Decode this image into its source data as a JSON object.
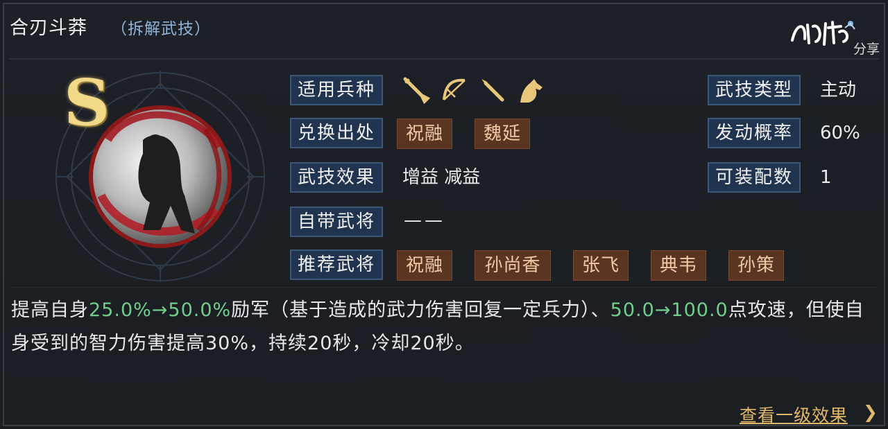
{
  "header": {
    "title": "合刃斗莽",
    "subtitle": "（拆解武技）",
    "brand_logo": "鸿图",
    "brand_share": "分享"
  },
  "skill": {
    "rank": "S",
    "attributes": {
      "troop_label": "适用兵种",
      "troop_icons": [
        "sword-icon",
        "bow-icon",
        "spear-icon",
        "horse-icon"
      ],
      "source_label": "兑换出处",
      "sources": [
        "祝融",
        "魏延"
      ],
      "effect_label": "武技效果",
      "effect_value": "增益 减益",
      "own_general_label": "自带武将",
      "own_general_value": "——",
      "recommend_label": "推荐武将",
      "recommended": [
        "祝融",
        "孙尚香",
        "张飞",
        "典韦",
        "孙策"
      ],
      "type_label": "武技类型",
      "type_value": "主动",
      "trigger_label": "发动概率",
      "trigger_value": "60%",
      "equip_label": "可装配数",
      "equip_value": "1"
    }
  },
  "description": {
    "p1": "提高自身",
    "h1": "25.0%→50.0%",
    "p2": "励军（基于造成的武力伤害回复一定兵力）、",
    "h2": "50.0→100.0",
    "p3": "点攻速，但使自身受到的智力伤害提高30%，持续20秒，冷却20秒。"
  },
  "footer": {
    "view_more": "查看一级效果",
    "arrow": "❯"
  },
  "colors": {
    "label_bg": "#21344f",
    "tag_bg": "#5a3522",
    "highlight": "#6fcf8a",
    "link": "#e0b86a",
    "icon_gold": "#e8c77a"
  }
}
